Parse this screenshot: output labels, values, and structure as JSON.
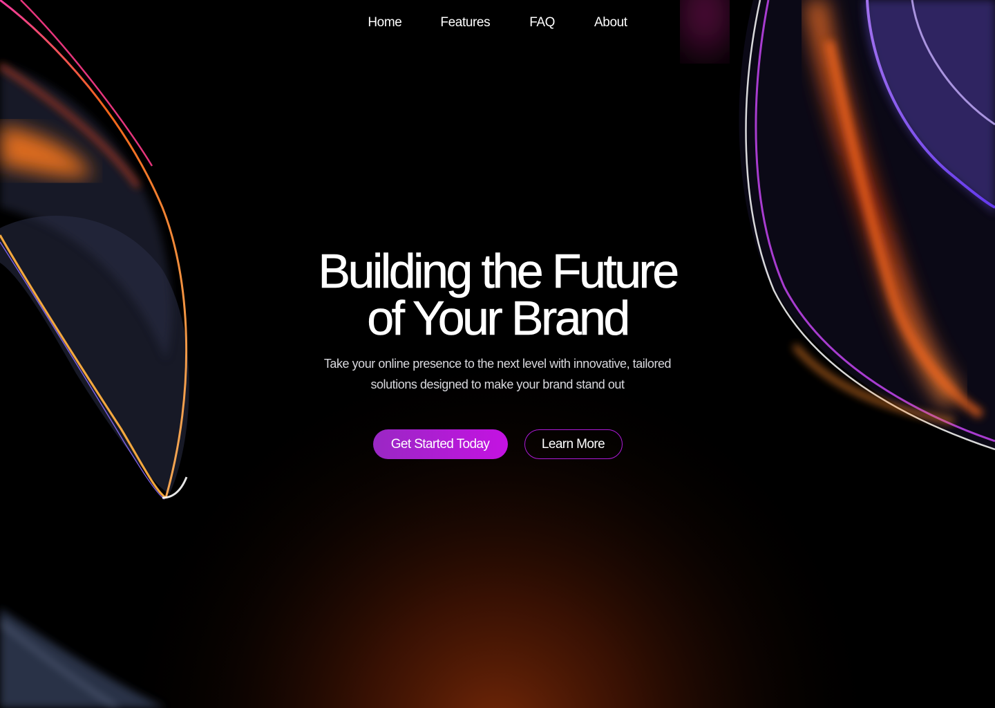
{
  "nav": {
    "items": [
      {
        "label": "Home"
      },
      {
        "label": "Features"
      },
      {
        "label": "FAQ"
      },
      {
        "label": "About"
      }
    ]
  },
  "hero": {
    "title_line1": "Building the Future",
    "title_line2": "of Your Brand",
    "subtitle": "Take your online presence to the next level with innovative, tailored solutions designed to make your brand stand out",
    "primary_cta": "Get Started Today",
    "secondary_cta": "Learn More"
  },
  "colors": {
    "background": "#000000",
    "accent_purple": "#b01ad8",
    "glow_orange": "#e0530e"
  }
}
